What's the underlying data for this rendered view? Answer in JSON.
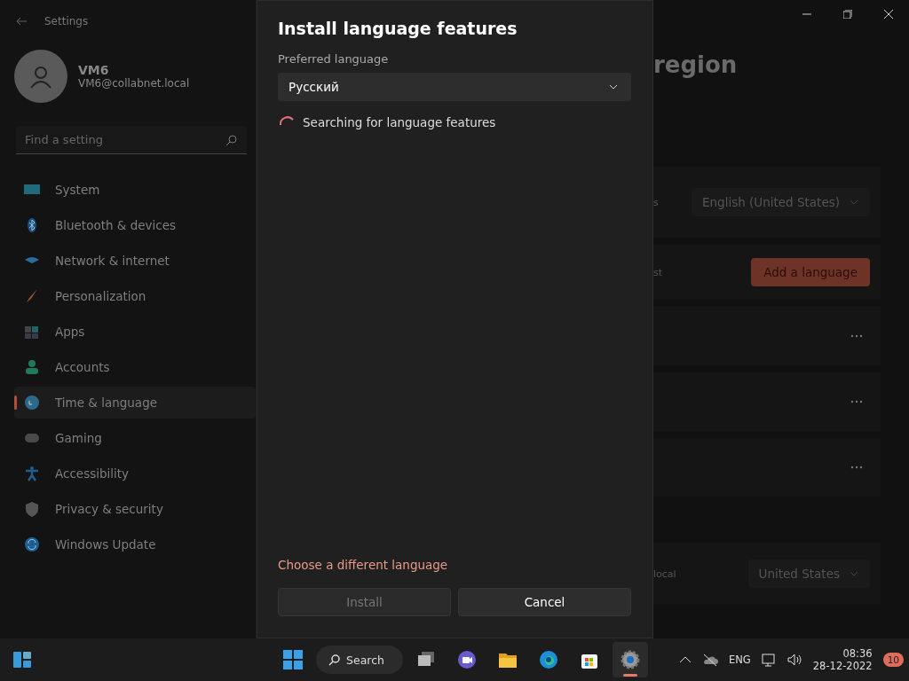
{
  "settings_window": {
    "title": "Settings",
    "user": {
      "name": "VM6",
      "email": "VM6@collabnet.local"
    },
    "search": {
      "placeholder": "Find a setting"
    },
    "nav": [
      {
        "label": "System",
        "kind": "system",
        "selected": false
      },
      {
        "label": "Bluetooth & devices",
        "kind": "bluetooth",
        "selected": false
      },
      {
        "label": "Network & internet",
        "kind": "network",
        "selected": false
      },
      {
        "label": "Personalization",
        "kind": "brush",
        "selected": false
      },
      {
        "label": "Apps",
        "kind": "apps",
        "selected": false
      },
      {
        "label": "Accounts",
        "kind": "accounts",
        "selected": false
      },
      {
        "label": "Time & language",
        "kind": "time",
        "selected": true
      },
      {
        "label": "Gaming",
        "kind": "gaming",
        "selected": false
      },
      {
        "label": "Accessibility",
        "kind": "accessibility",
        "selected": false
      },
      {
        "label": "Privacy & security",
        "kind": "shield",
        "selected": false
      },
      {
        "label": "Windows Update",
        "kind": "update",
        "selected": false
      }
    ],
    "page": {
      "heading": "region",
      "cards": [
        {
          "kind": "dropdown",
          "label": "s",
          "value": "English (United States)"
        },
        {
          "kind": "button",
          "label": "st",
          "button": "Add a language"
        },
        {
          "kind": "language"
        },
        {
          "kind": "language"
        },
        {
          "kind": "language"
        },
        {
          "kind": "spacer"
        },
        {
          "kind": "dropdown",
          "label": "local",
          "value": "United States"
        }
      ]
    }
  },
  "dialog": {
    "title": "Install language features",
    "field_label": "Preferred language",
    "select_value": "Русский",
    "status": "Searching for language features",
    "link": "Choose a different language",
    "buttons": [
      {
        "label": "Install",
        "disabled": true
      },
      {
        "label": "Cancel",
        "disabled": false
      }
    ]
  },
  "taskbar": {
    "search_label": "Search",
    "apps": [
      {
        "kind": "taskview",
        "active": false
      },
      {
        "kind": "chat",
        "active": false
      },
      {
        "kind": "folder",
        "active": false
      },
      {
        "kind": "browser",
        "active": false
      },
      {
        "kind": "store",
        "active": false
      },
      {
        "kind": "settings",
        "active": true
      }
    ],
    "language": "ENG",
    "time": "08:36",
    "date": "28-12-2022",
    "badge": "10"
  }
}
